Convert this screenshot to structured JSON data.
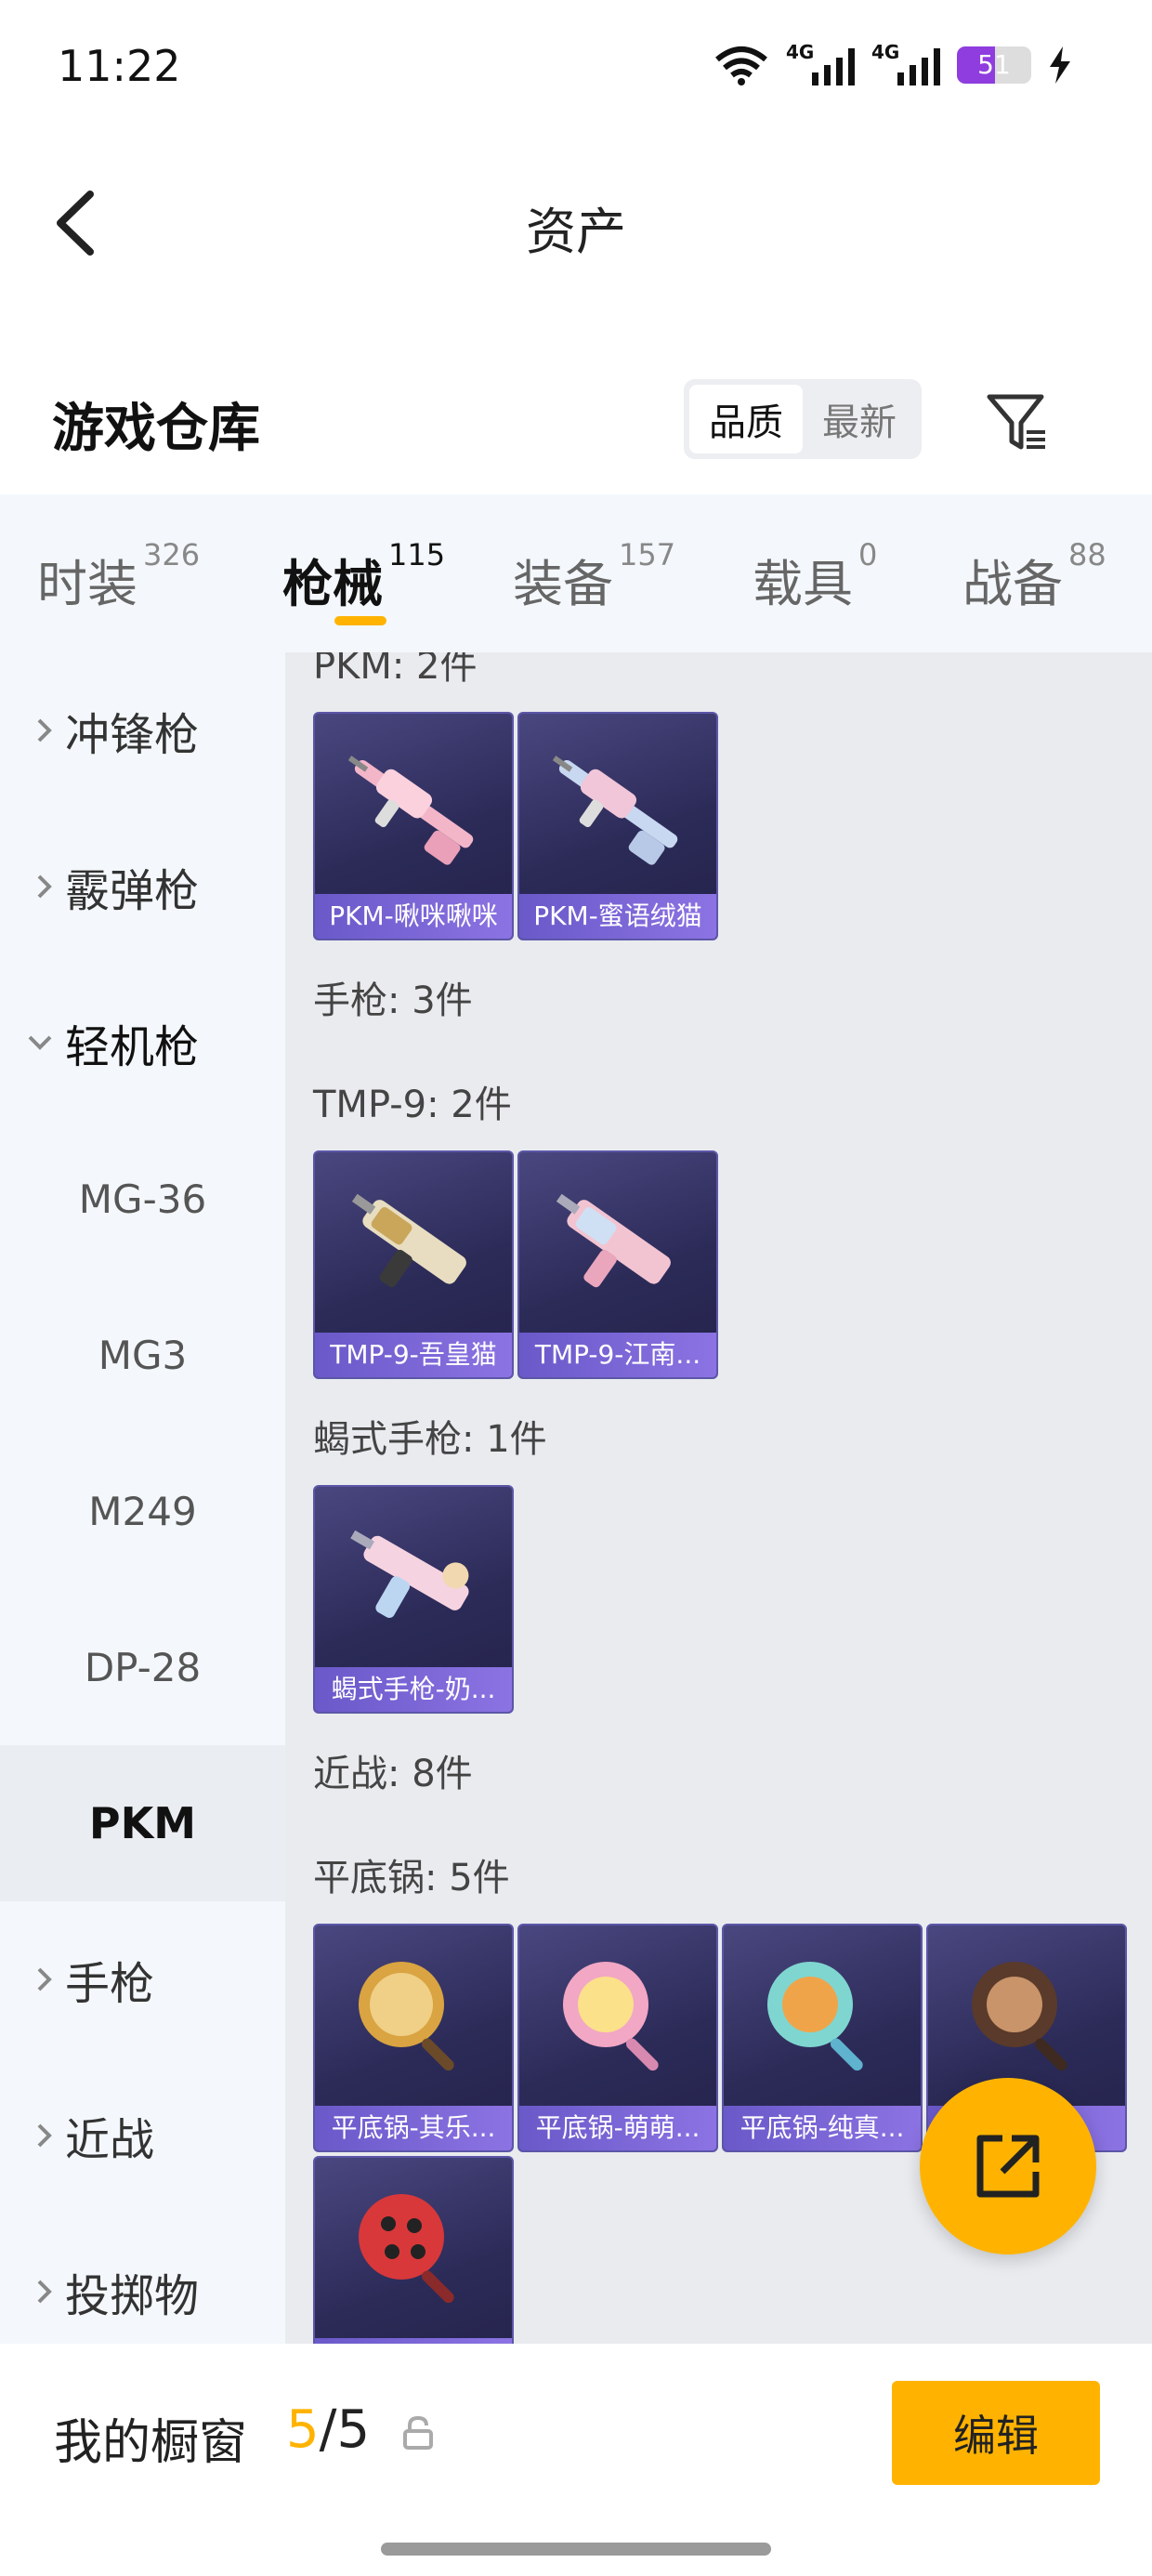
{
  "status": {
    "time": "11:22",
    "net1": "4G",
    "net2": "4G",
    "battery": "51",
    "battery_level": 0.51
  },
  "header": {
    "title": "资产"
  },
  "section": {
    "title": "游戏仓库",
    "sort": [
      "品质",
      "最新"
    ]
  },
  "tabs": [
    {
      "label": "时装",
      "count": "326"
    },
    {
      "label": "枪械",
      "count": "115"
    },
    {
      "label": "装备",
      "count": "157"
    },
    {
      "label": "载具",
      "count": "0"
    },
    {
      "label": "战备",
      "count": "88"
    }
  ],
  "sidebar": {
    "items": [
      "冲锋枪",
      "霰弹枪",
      "轻机枪"
    ],
    "sub_items": [
      "MG-36",
      "MG3",
      "M249",
      "DP-28",
      "PKM"
    ],
    "items_after": [
      "手枪",
      "近战",
      "投掷物"
    ]
  },
  "content": {
    "groups": {
      "pkm": "PKM: 2件",
      "pistol": "手枪: 3件",
      "tmp9": "TMP-9: 2件",
      "scorpion": "蝎式手枪: 1件",
      "melee": "近战: 8件",
      "pan": "平底锅: 5件"
    },
    "cards": {
      "pkm": [
        "PKM-啾咪啾咪",
        "PKM-蜜语绒猫"
      ],
      "tmp9": [
        "TMP-9-吾皇猫",
        "TMP-9-江南..."
      ],
      "scorpion": [
        "蝎式手枪-奶..."
      ],
      "pan": [
        "平底锅-其乐...",
        "平底锅-萌萌...",
        "平底锅-纯真...",
        "...",
        ""
      ]
    }
  },
  "bottom": {
    "showcase_label": "我的橱窗",
    "current": "5",
    "total": "/5",
    "edit": "编辑"
  },
  "colors": {
    "accent": "#ffb300",
    "card_bg": "#2c2b58",
    "card_label": "#7a66d6",
    "battery": "#8f3ddf"
  }
}
